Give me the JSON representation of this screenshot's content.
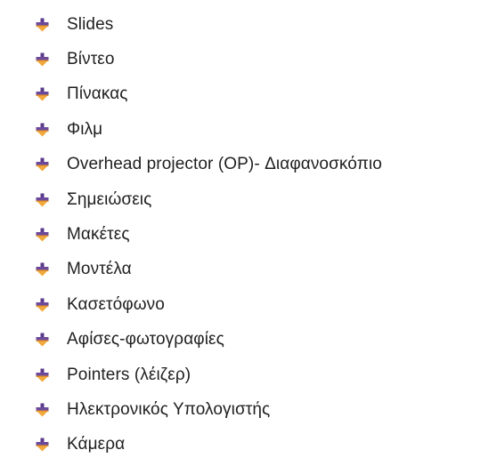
{
  "bullet_icon": "plus-arrow-bullet-icon",
  "colors": {
    "bullet_top": "#5a3a8a",
    "bullet_bottom": "#f2a93b",
    "text": "#1f1f1f"
  },
  "items": [
    {
      "label": "Slides"
    },
    {
      "label": "Βίντεο"
    },
    {
      "label": "Πίνακας"
    },
    {
      "label": "Φιλμ"
    },
    {
      "label": "Overhead projector (OP)- Διαφανοσκόπιο"
    },
    {
      "label": "Σημειώσεις"
    },
    {
      "label": "Μακέτες"
    },
    {
      "label": "Μοντέλα"
    },
    {
      "label": "Κασετόφωνο"
    },
    {
      "label": "Αφίσες-φωτογραφίες"
    },
    {
      "label": "Pointers (λέιζερ)"
    },
    {
      "label": "Ηλεκτρονικός Υπολογιστής"
    },
    {
      "label": "Κάμερα"
    }
  ]
}
